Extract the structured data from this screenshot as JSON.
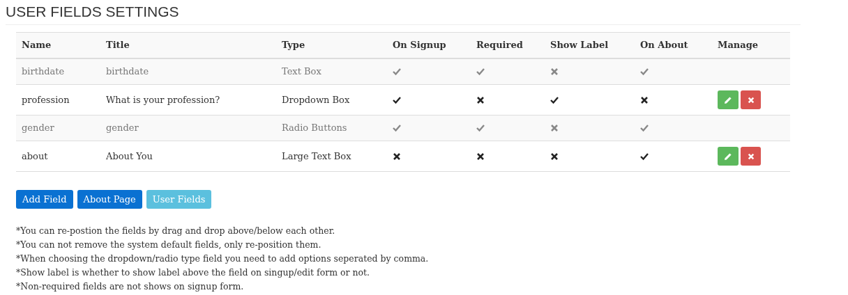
{
  "title": "USER FIELDS SETTINGS",
  "table": {
    "columns": [
      "Name",
      "Title",
      "Type",
      "On Signup",
      "Required",
      "Show Label",
      "On About",
      "Manage"
    ],
    "rows": [
      {
        "system": true,
        "name": "birthdate",
        "title": "birthdate",
        "type": "Text Box",
        "on_signup": true,
        "required": true,
        "show_label": false,
        "on_about": true
      },
      {
        "system": false,
        "name": "profession",
        "title": "What is your profession?",
        "type": "Dropdown Box",
        "on_signup": true,
        "required": false,
        "show_label": true,
        "on_about": false
      },
      {
        "system": true,
        "name": "gender",
        "title": "gender",
        "type": "Radio Buttons",
        "on_signup": true,
        "required": true,
        "show_label": false,
        "on_about": true
      },
      {
        "system": false,
        "name": "about",
        "title": "About You",
        "type": "Large Text Box",
        "on_signup": false,
        "required": false,
        "show_label": false,
        "on_about": true
      }
    ]
  },
  "buttons": [
    {
      "label": "Add Field",
      "selected": false
    },
    {
      "label": "About Page",
      "selected": false
    },
    {
      "label": "User Fields",
      "selected": true
    }
  ],
  "notes": [
    "*You can re-postion the fields by drag and drop above/below each other.",
    "*You can not remove the system default fields, only re-position them.",
    "*When choosing the dropdown/radio type field you need to add options seperated by comma.",
    "*Show label is whether to show label above the field on singup/edit form or not.",
    "*Non-required fields are not shows on signup form."
  ]
}
